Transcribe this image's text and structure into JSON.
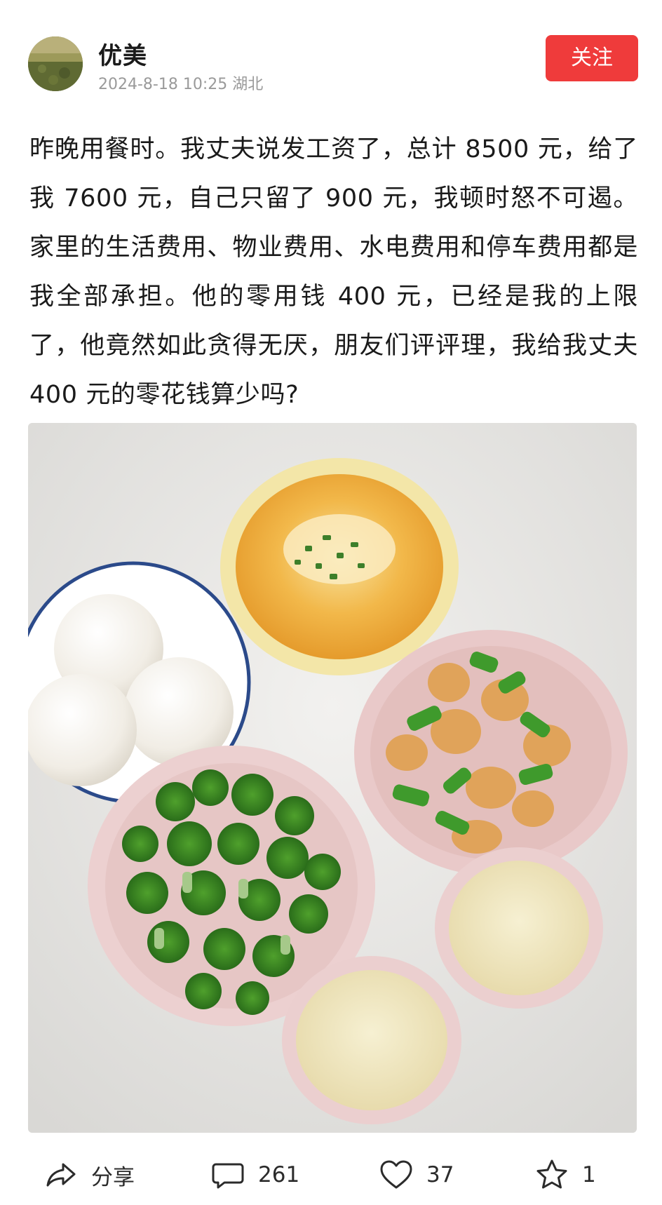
{
  "header": {
    "username": "优美",
    "timestamp": "2024-8-18 10:25",
    "location": "湖北",
    "follow_label": "关注"
  },
  "post": {
    "text": "昨晚用餐时。我丈夫说发工资了，总计 8500 元，给了我 7600 元，自己只留了 900 元，我顿时怒不可遏。家里的生活费用、物业费用、水电费用和停车费用都是我全部承担。他的零用钱 400 元，已经是我的上限了，他竟然如此贪得无厌，朋友们评评理，我给我丈夫 400 元的零花钱算少吗?"
  },
  "actions": {
    "share_label": "分享",
    "comment_count": "261",
    "like_count": "37",
    "star_count": "1"
  },
  "colors": {
    "accent": "#ef3b3b",
    "meta_text": "#9a9a9a"
  },
  "icons": [
    "share-icon",
    "comment-icon",
    "heart-icon",
    "star-icon"
  ]
}
